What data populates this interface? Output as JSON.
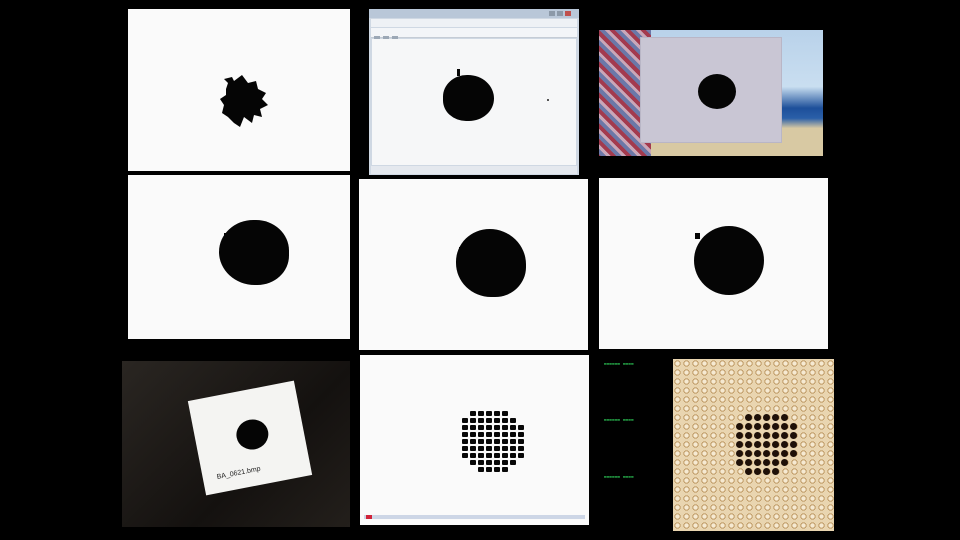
{
  "panels": [
    {
      "id": "threshold-blob"
    },
    {
      "id": "desktop-window"
    },
    {
      "id": "scene-board"
    },
    {
      "id": "blob-left"
    },
    {
      "id": "blob-center"
    },
    {
      "id": "blob-circle"
    },
    {
      "id": "paper-photo",
      "caption": "BA_0621.bmp"
    },
    {
      "id": "dot-grid",
      "ticks": [
        "",
        "",
        "",
        "",
        ""
      ]
    },
    {
      "id": "weave-grid"
    }
  ],
  "colors": {
    "background": "#000000",
    "blob": "#050505",
    "weave_dot": "#1e1008",
    "readout_green": "#2fd45c"
  }
}
